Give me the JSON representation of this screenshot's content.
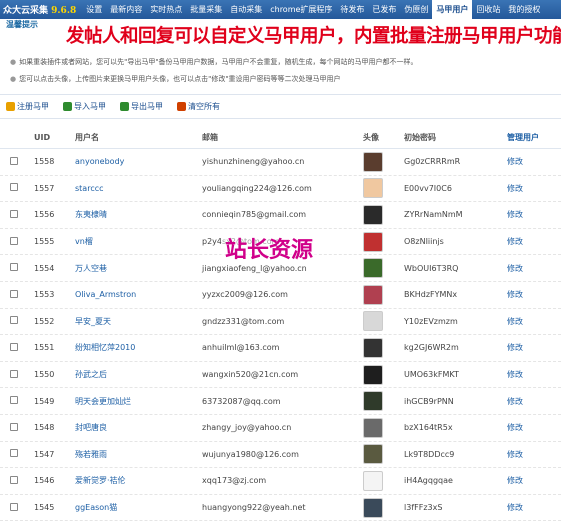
{
  "topnav": {
    "brand": "众大云采集",
    "version": "9.6.8",
    "items": [
      "设置",
      "最新内容",
      "实时热点",
      "批量采集",
      "自动采集",
      "chrome扩展程序",
      "待发布",
      "已发布",
      "伪原创",
      "马甲用户",
      "回收站",
      "我的授权"
    ],
    "active_index": 9
  },
  "overlay_title": "发帖人和回复可以自定义马甲用户，内置批量注册马甲用户功能",
  "tips": {
    "title": "温馨提示",
    "lines": [
      "如果重装插件或者网站，您可以先\"导出马甲\"备份马甲用户数据，马甲用户不会重复，随机生成，每个网站的马甲用户都不一样。",
      "您可以点击头像，上传图片来更换马甲用户头像，也可以点击\"修改\"重设用户密码等等二次处理马甲用户"
    ]
  },
  "actions": [
    {
      "label": "注册马甲",
      "color": "#e8a000"
    },
    {
      "label": "导入马甲",
      "color": "#2e8b2e"
    },
    {
      "label": "导出马甲",
      "color": "#2e8b2e"
    },
    {
      "label": "清空所有",
      "color": "#d04000"
    }
  ],
  "table": {
    "headers": {
      "uid": "UID",
      "username": "用户名",
      "email": "邮箱",
      "avatar": "头像",
      "password": "初始密码",
      "manage": "管理用户"
    },
    "edit_label": "修改",
    "rows": [
      {
        "uid": "1558",
        "username": "anyonebody",
        "email": "yishunzhineng@yahoo.cn",
        "password": "Gg0zCRRRmR",
        "avatar_color": "#5a3d2e"
      },
      {
        "uid": "1557",
        "username": "starccc",
        "email": "youliangqing224@126.com",
        "password": "E00vv7I0C6",
        "avatar_color": "#f0c8a0"
      },
      {
        "uid": "1556",
        "username": "东夷棣晴",
        "email": "connieqin785@gmail.com",
        "password": "ZYRrNamNmM",
        "avatar_color": "#2a2a2a"
      },
      {
        "uid": "1555",
        "username": "vn榴",
        "email": "p2y4sx2@tom.com",
        "password": "O8zNIiinjs",
        "avatar_color": "#c03030"
      },
      {
        "uid": "1554",
        "username": "万人空巷",
        "email": "jiangxiaofeng_l@yahoo.cn",
        "password": "WbOUI6T3RQ",
        "avatar_color": "#3a6a2a"
      },
      {
        "uid": "1553",
        "username": "Oliva_Armstron",
        "email": "yyzxc2009@126.com",
        "password": "BKHdzFYMNx",
        "avatar_color": "#b04050"
      },
      {
        "uid": "1552",
        "username": "早安_夏天",
        "email": "gndzz331@tom.com",
        "password": "Y10zEVzmzm",
        "avatar_color": "#d8d8d8"
      },
      {
        "uid": "1551",
        "username": "纷知相忆萍2010",
        "email": "anhuilml@163.com",
        "password": "kg2GJ6WR2m",
        "avatar_color": "#333333"
      },
      {
        "uid": "1550",
        "username": "孙武之后",
        "email": "wangxin520@21cn.com",
        "password": "UMO63kFMKT",
        "avatar_color": "#1e1e1e"
      },
      {
        "uid": "1549",
        "username": "明天会更加灿烂",
        "email": "63732087@qq.com",
        "password": "ihGCB9rPNN",
        "avatar_color": "#2f3a2a"
      },
      {
        "uid": "1548",
        "username": "封吧唐良",
        "email": "zhangy_joy@yahoo.cn",
        "password": "bzX164tR5x",
        "avatar_color": "#6a6a6a"
      },
      {
        "uid": "1547",
        "username": "殇若雅雨",
        "email": "wujunya1980@126.com",
        "password": "Lk9T8DDcc9",
        "avatar_color": "#5a5a40"
      },
      {
        "uid": "1546",
        "username": "爱新觉罗·袺伦",
        "email": "xqq173@zj.com",
        "password": "iH4Agqgqae",
        "avatar_color": "#f4f4f4"
      },
      {
        "uid": "1545",
        "username": "ggEason猫",
        "email": "huangyong922@yeah.net",
        "password": "l3fFFz3xS",
        "avatar_color": "#3a4a5a"
      }
    ]
  },
  "watermark": "站长资源"
}
